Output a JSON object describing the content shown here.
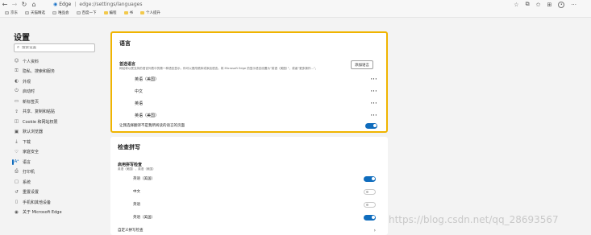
{
  "browser": {
    "address_brand": "Edge",
    "address_path": "edge://settings/languages",
    "bookmarks": [
      {
        "label": "京东",
        "kind": "page"
      },
      {
        "label": "天猫精选",
        "kind": "page"
      },
      {
        "label": "唯品会",
        "kind": "page"
      },
      {
        "label": "百度一下",
        "kind": "page"
      },
      {
        "label": "编程",
        "kind": "folder"
      },
      {
        "label": "书",
        "kind": "folder"
      },
      {
        "label": "个人提升",
        "kind": "folder"
      }
    ]
  },
  "sidebar": {
    "title": "设置",
    "search_placeholder": "搜索设置",
    "items": [
      {
        "label": "个人资料",
        "icon": "person-icon"
      },
      {
        "label": "隐私、搜索和服务",
        "icon": "lock-icon"
      },
      {
        "label": "外观",
        "icon": "palette-icon"
      },
      {
        "label": "启动时",
        "icon": "power-icon"
      },
      {
        "label": "新标签页",
        "icon": "tab-icon"
      },
      {
        "label": "共享、复制和粘贴",
        "icon": "share-icon"
      },
      {
        "label": "Cookie 和网站权限",
        "icon": "cookie-icon"
      },
      {
        "label": "默认浏览器",
        "icon": "browser-icon"
      },
      {
        "label": "下载",
        "icon": "download-icon"
      },
      {
        "label": "家庭安全",
        "icon": "family-icon"
      },
      {
        "label": "语言",
        "icon": "language-icon",
        "active": true
      },
      {
        "label": "打印机",
        "icon": "printer-icon"
      },
      {
        "label": "系统",
        "icon": "system-icon"
      },
      {
        "label": "重置设置",
        "icon": "reset-icon"
      },
      {
        "label": "手机和其他设备",
        "icon": "phone-icon"
      },
      {
        "label": "关于 Microsoft Edge",
        "icon": "edge-icon"
      }
    ]
  },
  "languages": {
    "title": "语言",
    "preferred_title": "首选语言",
    "preferred_desc": "网站将以受支持的语言列表中的第一种语言显示。你可以更改顺序或添加语言。将 Microsoft Edge 的显示语言设置为“英语（美国）”，或者“更多操作...”。",
    "add_button": "添加语言",
    "rows": [
      {
        "name": "英语（美国）"
      },
      {
        "name": "中文"
      },
      {
        "name": "英语"
      },
      {
        "name": "英语（美国）"
      }
    ],
    "more_label": "···",
    "translate_toggle_label": "让我选择翻译不是我所阅读的语言的页面",
    "translate_toggle_on": true
  },
  "spellcheck": {
    "title": "检查拼写",
    "enable_label": "启用拼写检查",
    "enable_sub": "英语（美国）、英语（美国）",
    "rows": [
      {
        "name": "英语（美国）",
        "on": true
      },
      {
        "name": "中文",
        "on": false
      },
      {
        "name": "英语",
        "on": false
      },
      {
        "name": "英语（美国）",
        "on": true
      }
    ],
    "custom_label": "自定义拼写检查",
    "chevron": "›"
  },
  "watermark": "https://blog.csdn.net/qq_28693567",
  "colors": {
    "accent": "#0f6cbd",
    "highlight_border": "#f0b400",
    "folder": "#f2c94c"
  }
}
